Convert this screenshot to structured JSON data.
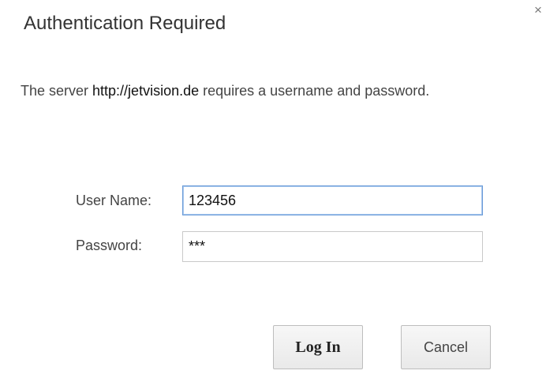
{
  "dialog": {
    "title": "Authentication Required",
    "close_icon": "close-icon",
    "message_prefix": "The server ",
    "server_url": "http://jetvision.de",
    "message_suffix": " requires a username and password."
  },
  "form": {
    "username_label": "User Name:",
    "username_value": "123456",
    "password_label": "Password:",
    "password_value": "***"
  },
  "buttons": {
    "login_label": "Log In",
    "cancel_label": "Cancel"
  },
  "colors": {
    "focus_border": "#6a9bd8",
    "text": "#444444",
    "button_border": "#bdbdbd"
  }
}
